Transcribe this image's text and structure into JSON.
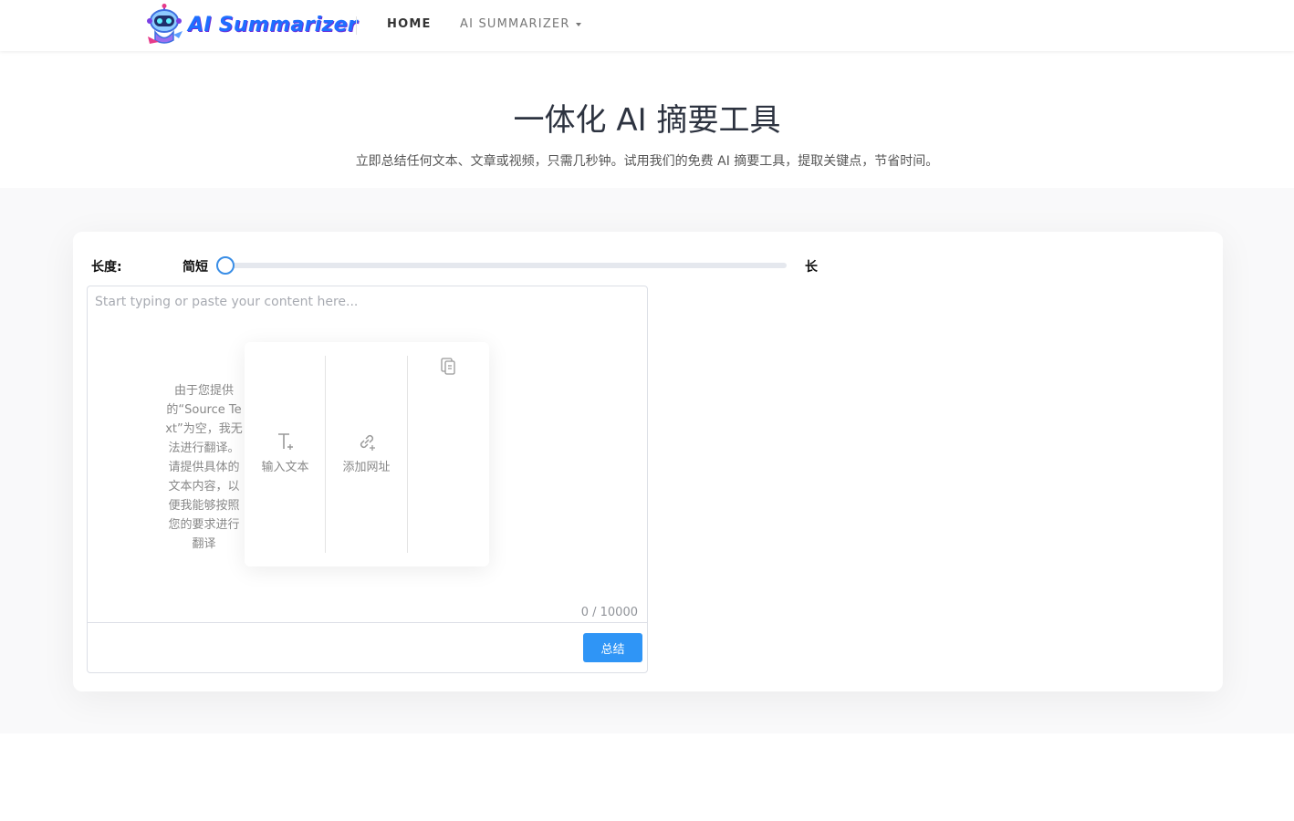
{
  "header": {
    "logo_text": "AI Summarizer",
    "nav": {
      "home": "HOME",
      "ai_summarizer": "AI SUMMARIZER"
    }
  },
  "hero": {
    "title": "一体化 AI 摘要工具",
    "subtitle": "立即总结任何文本、文章或视频，只需几秒钟。试用我们的免费 AI 摘要工具，提取关键点，节省时间。"
  },
  "length": {
    "label": "长度:",
    "short_label": "简短",
    "long_label": "长",
    "value": 0
  },
  "editor": {
    "placeholder": "Start typing or paste your content here...",
    "char_count": "0 / 10000",
    "submit_label": "总结"
  },
  "options": [
    {
      "label": "输入文本",
      "icon": "text-add-icon"
    },
    {
      "label": "添加网址",
      "icon": "link-add-icon"
    },
    {
      "label": "由于您提供的“Source Text”为空，我无法进行翻译。请提供具体的文本内容，以便我能够按照您的要求进行翻译",
      "icon": "paste-icon"
    }
  ],
  "colors": {
    "accent": "#2f95f6",
    "slider_thumb": "#3a8ee6",
    "logo": "#1e6fff"
  }
}
